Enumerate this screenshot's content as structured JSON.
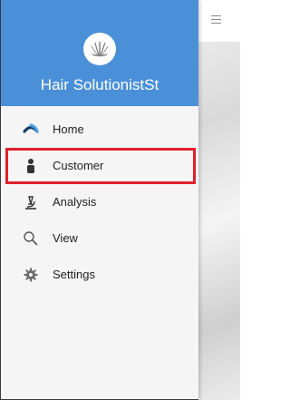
{
  "app": {
    "title": "Hair SolutionistSt"
  },
  "toolbar": {
    "menu_icon": "hamburger-icon"
  },
  "drawer": {
    "header_color": "#4a90d9",
    "highlight_color": "#e0202a",
    "items": [
      {
        "label": "Home",
        "icon": "home-icon"
      },
      {
        "label": "Customer",
        "icon": "customer-icon"
      },
      {
        "label": "Analysis",
        "icon": "microscope-icon"
      },
      {
        "label": "View",
        "icon": "search-icon"
      },
      {
        "label": "Settings",
        "icon": "gear-icon"
      }
    ]
  }
}
